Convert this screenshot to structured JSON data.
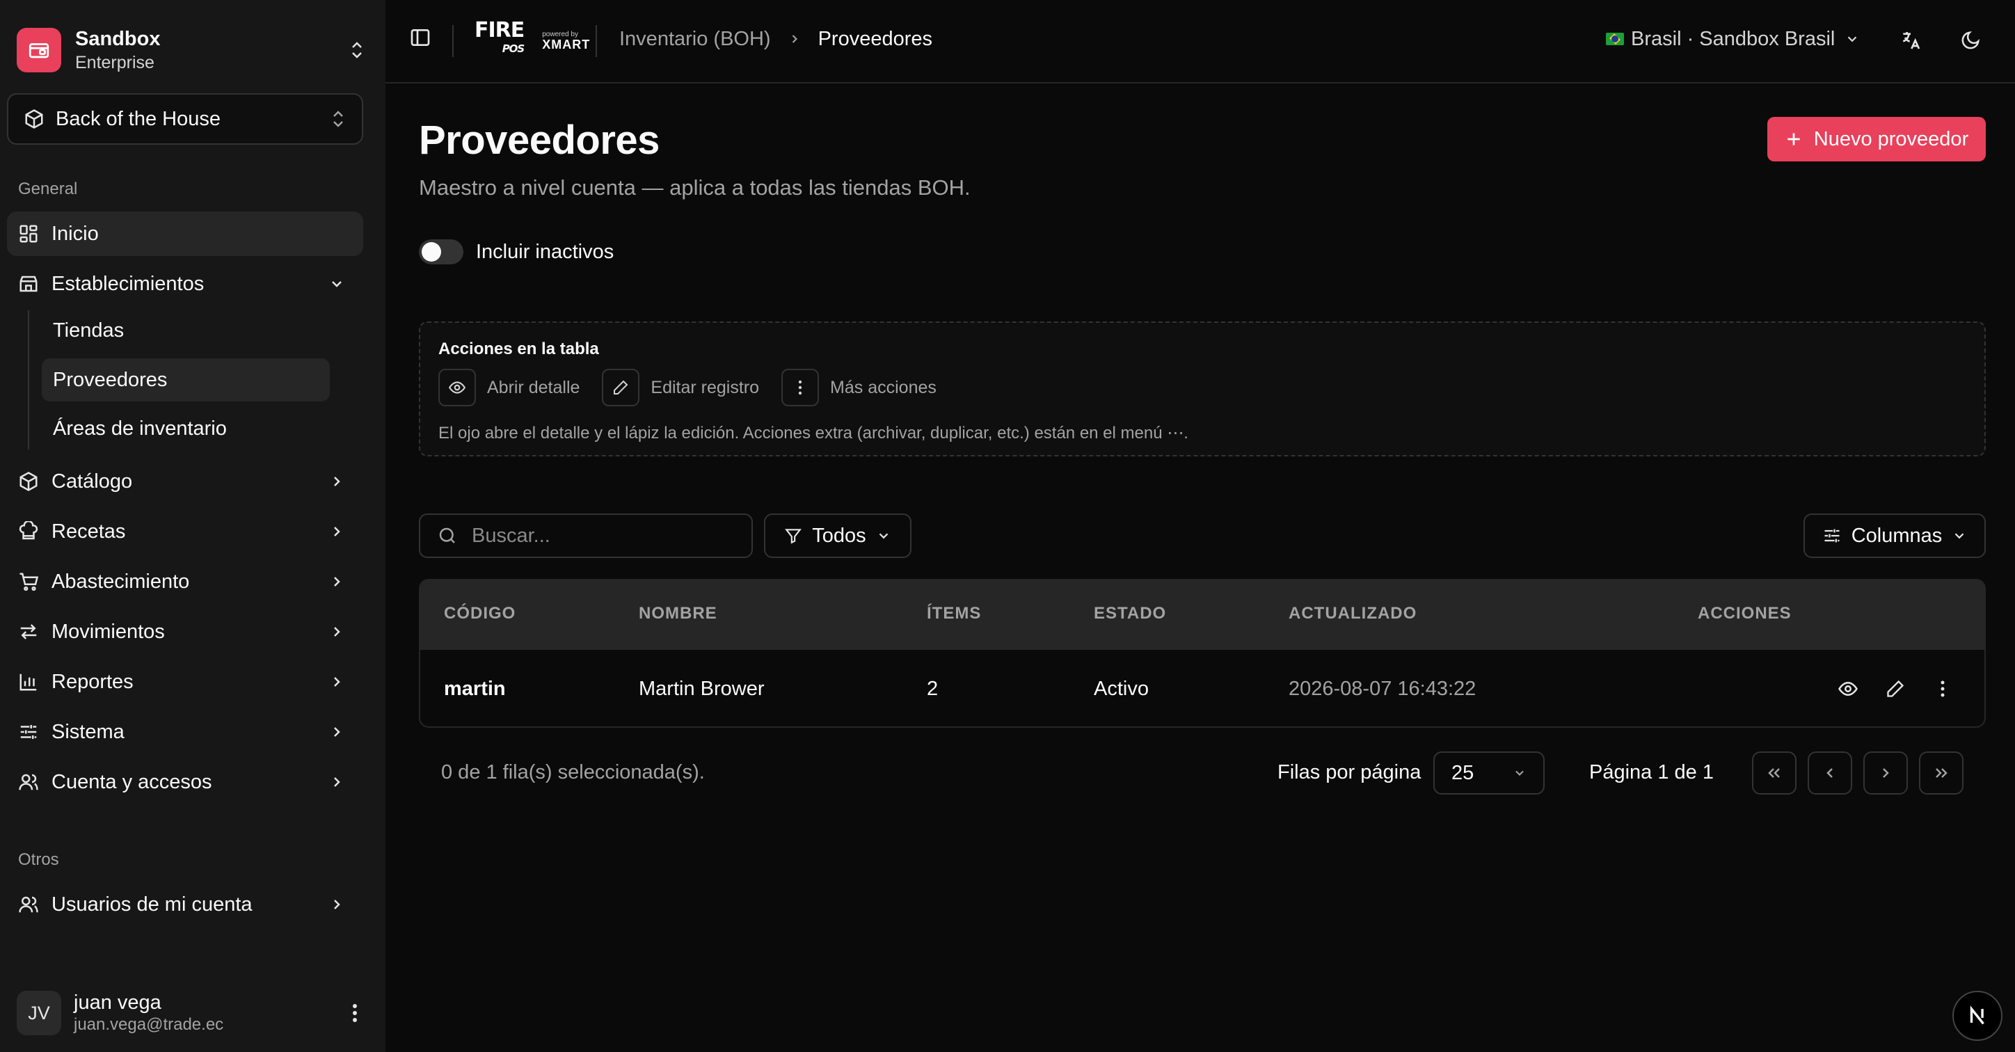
{
  "org": {
    "name": "Sandbox",
    "plan": "Enterprise"
  },
  "module": {
    "label": "Back of the House"
  },
  "sidebar": {
    "general_label": "General",
    "others_label": "Otros",
    "items": [
      {
        "label": "Inicio",
        "icon": "dashboard-icon"
      },
      {
        "label": "Establecimientos",
        "icon": "store-icon"
      },
      {
        "label": "Catálogo",
        "icon": "package-icon"
      },
      {
        "label": "Recetas",
        "icon": "chef-hat-icon"
      },
      {
        "label": "Abastecimiento",
        "icon": "cart-icon"
      },
      {
        "label": "Movimientos",
        "icon": "arrows-icon"
      },
      {
        "label": "Reportes",
        "icon": "bar-chart-icon"
      },
      {
        "label": "Sistema",
        "icon": "sliders-icon"
      },
      {
        "label": "Cuenta y accesos",
        "icon": "users-icon"
      }
    ],
    "sub_items": [
      "Tiendas",
      "Proveedores",
      "Áreas de inventario"
    ],
    "others_items": [
      {
        "label": "Usuarios de mi cuenta",
        "icon": "users-icon"
      }
    ]
  },
  "user": {
    "initials": "JV",
    "name": "juan vega",
    "email": "juan.vega@trade.ec"
  },
  "topbar": {
    "brand_fire": "FIRE",
    "brand_pos": "POS",
    "powered_by": "powered by",
    "powered_brand": "XMART",
    "breadcrumb": [
      "Inventario (BOH)",
      "Proveedores"
    ],
    "country": "Brasil · Sandbox Brasil"
  },
  "page": {
    "title": "Proveedores",
    "subtitle": "Maestro a nivel cuenta — aplica a todas las tiendas BOH.",
    "new_button": "Nuevo proveedor",
    "include_inactive": "Incluir inactivos"
  },
  "help": {
    "title": "Acciones en la tabla",
    "actions": [
      "Abrir detalle",
      "Editar registro",
      "Más acciones"
    ],
    "note": "El ojo abre el detalle y el lápiz la edición. Acciones extra (archivar, duplicar, etc.) están en el menú ⋯."
  },
  "toolbar": {
    "search_placeholder": "Buscar...",
    "filter": "Todos",
    "columns": "Columnas"
  },
  "table": {
    "headers": [
      "CÓDIGO",
      "NOMBRE",
      "ÍTEMS",
      "ESTADO",
      "ACTUALIZADO",
      "ACCIONES"
    ],
    "rows": [
      {
        "code": "martin",
        "name": "Martin Brower",
        "items": "2",
        "status": "Activo",
        "updated": "2026-08-07 16:43:22"
      }
    ]
  },
  "footer": {
    "selection": "0 de 1 fila(s) seleccionada(s).",
    "rows_per_page_label": "Filas por página",
    "rows_per_page": "25",
    "page_info": "Página 1 de 1"
  },
  "colors": {
    "accent": "#e9405b",
    "background": "#0a0a0a",
    "sidebar": "#171717"
  }
}
